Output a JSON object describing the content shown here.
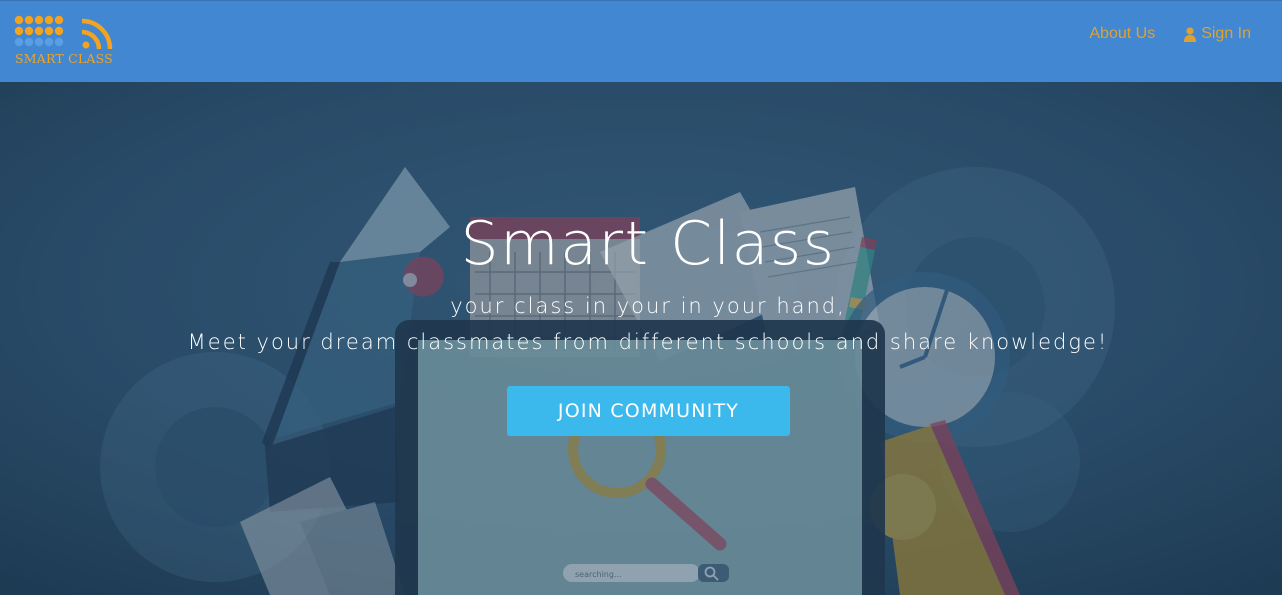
{
  "brand": {
    "name": "SMART CLASS"
  },
  "nav": {
    "about_label": "About Us",
    "signin_label": "Sign In",
    "signin_icon": "user-icon"
  },
  "hero": {
    "title": "Smart Class",
    "subtitle_line1": "your class in your in your hand,",
    "subtitle_line2": "Meet your dream classmates from different schools and share knowledge!",
    "cta_label": "JOIN COMMUNITY",
    "search_placeholder": "searching..."
  },
  "colors": {
    "navbar": "#4287d1",
    "accent": "#e0a12d",
    "cta": "#3bb8ec",
    "hero_bg": "#2a4d68"
  }
}
